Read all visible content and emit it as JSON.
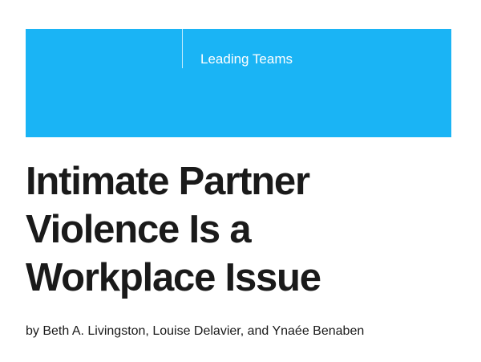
{
  "banner": {
    "label": "Leading Teams",
    "color": "#1ab4f5"
  },
  "article": {
    "title_lines": [
      "Intimate Partner",
      "Violence Is a",
      "Workplace Issue"
    ],
    "byline": "by Beth A. Livingston, Louise Delavier, and Ynaée Benaben"
  }
}
